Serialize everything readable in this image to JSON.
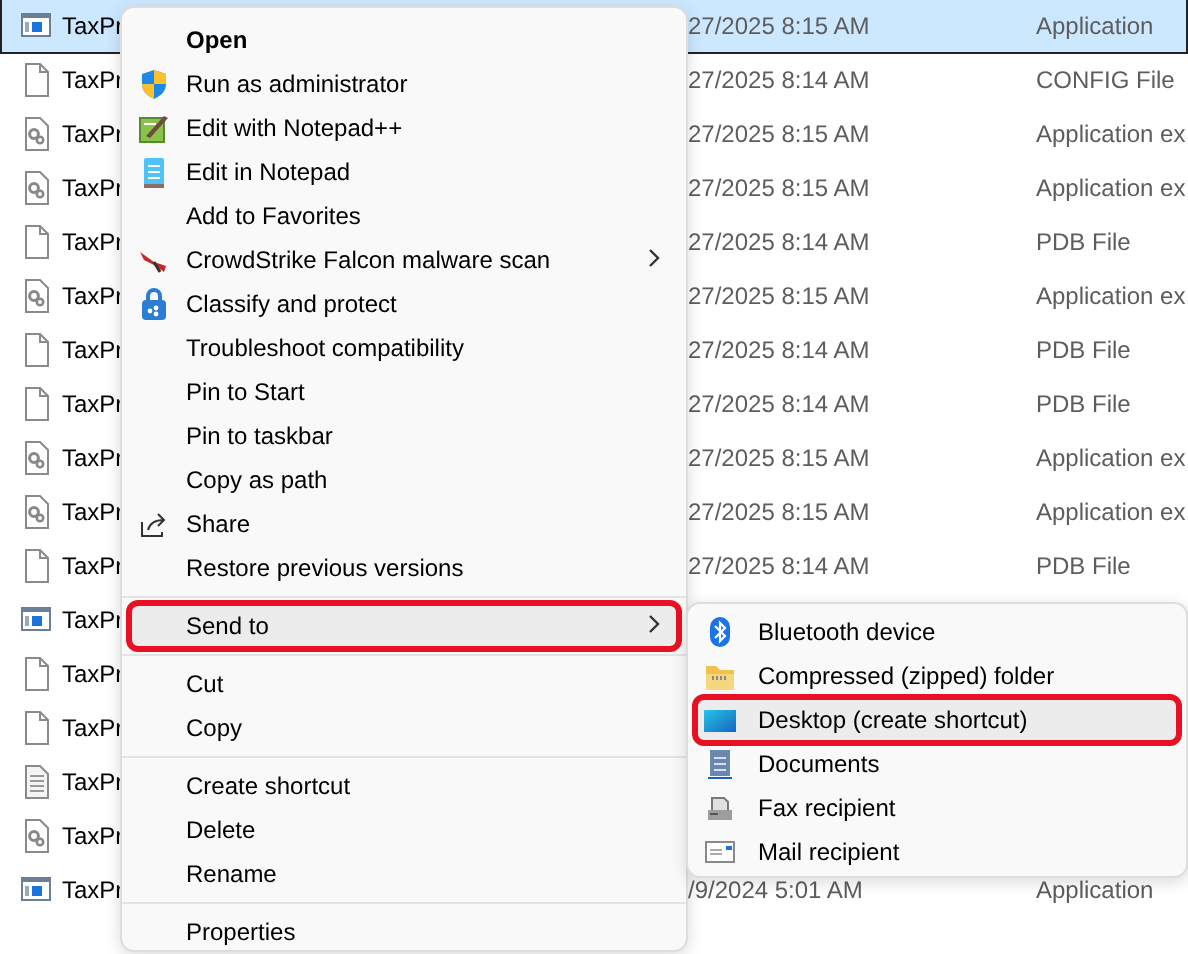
{
  "files": [
    {
      "kind": "app",
      "name": "TaxPr",
      "modified": "27/2025 8:15 AM",
      "type": "Application",
      "selected": true
    },
    {
      "kind": "blank",
      "name": "TaxPr",
      "modified": "27/2025 8:14 AM",
      "type": "CONFIG File",
      "selected": false
    },
    {
      "kind": "gear",
      "name": "TaxPr",
      "modified": "27/2025 8:15 AM",
      "type": "Application ex",
      "selected": false
    },
    {
      "kind": "gear",
      "name": "TaxPr",
      "modified": "27/2025 8:15 AM",
      "type": "Application ex",
      "selected": false
    },
    {
      "kind": "blank",
      "name": "TaxPr",
      "modified": "27/2025 8:14 AM",
      "type": "PDB File",
      "selected": false
    },
    {
      "kind": "gear",
      "name": "TaxPr",
      "modified": "27/2025 8:15 AM",
      "type": "Application ex",
      "selected": false
    },
    {
      "kind": "blank",
      "name": "TaxPr",
      "modified": "27/2025 8:14 AM",
      "type": "PDB File",
      "selected": false
    },
    {
      "kind": "blank",
      "name": "TaxPr",
      "modified": "27/2025 8:14 AM",
      "type": "PDB File",
      "selected": false
    },
    {
      "kind": "gear",
      "name": "TaxPr",
      "modified": "27/2025 8:15 AM",
      "type": "Application ex",
      "selected": false
    },
    {
      "kind": "gear",
      "name": "TaxPr",
      "modified": "27/2025 8:15 AM",
      "type": "Application ex",
      "selected": false
    },
    {
      "kind": "blank",
      "name": "TaxPr",
      "modified": "27/2025 8:14 AM",
      "type": "PDB File",
      "selected": false
    },
    {
      "kind": "app",
      "name": "TaxPr",
      "selected": false
    },
    {
      "kind": "blank",
      "name": "TaxPr",
      "selected": false
    },
    {
      "kind": "blank",
      "name": "TaxPr",
      "selected": false
    },
    {
      "kind": "text",
      "name": "TaxPr",
      "selected": false
    },
    {
      "kind": "gear",
      "name": "TaxPr",
      "selected": false
    },
    {
      "kind": "app",
      "name": "TaxPr",
      "modified": "/9/2024 5:01 AM",
      "type": "Application",
      "selected": false
    }
  ],
  "context_menu": [
    {
      "kind": "item",
      "label": "Open",
      "default": true
    },
    {
      "kind": "item",
      "label": "Run as administrator"
    },
    {
      "kind": "item",
      "label": "Edit with Notepad++"
    },
    {
      "kind": "item",
      "label": "Edit in Notepad"
    },
    {
      "kind": "item",
      "label": "Add to Favorites"
    },
    {
      "kind": "item",
      "label": "CrowdStrike Falcon malware scan",
      "submenu": true
    },
    {
      "kind": "item",
      "label": "Classify and protect"
    },
    {
      "kind": "item",
      "label": "Troubleshoot compatibility"
    },
    {
      "kind": "item",
      "label": "Pin to Start"
    },
    {
      "kind": "item",
      "label": "Pin to taskbar"
    },
    {
      "kind": "item",
      "label": "Copy as path"
    },
    {
      "kind": "item",
      "label": "Share"
    },
    {
      "kind": "item",
      "label": "Restore previous versions"
    },
    {
      "kind": "separator"
    },
    {
      "kind": "item",
      "label": "Send to",
      "submenu": true,
      "selected": true,
      "annotated": true
    },
    {
      "kind": "separator"
    },
    {
      "kind": "item",
      "label": "Cut"
    },
    {
      "kind": "item",
      "label": "Copy"
    },
    {
      "kind": "separator"
    },
    {
      "kind": "item",
      "label": "Create shortcut"
    },
    {
      "kind": "item",
      "label": "Delete"
    },
    {
      "kind": "item",
      "label": "Rename"
    },
    {
      "kind": "separator"
    },
    {
      "kind": "item",
      "label": "Properties"
    }
  ],
  "send_to_menu": [
    {
      "label": "Bluetooth device",
      "selected": false,
      "annotated": false
    },
    {
      "label": "Compressed (zipped) folder",
      "selected": false,
      "annotated": false
    },
    {
      "label": "Desktop (create shortcut)",
      "selected": true,
      "annotated": true
    },
    {
      "label": "Documents",
      "selected": false,
      "annotated": false
    },
    {
      "label": "Fax recipient",
      "selected": false,
      "annotated": false
    },
    {
      "label": "Mail recipient",
      "selected": false,
      "annotated": false
    }
  ]
}
